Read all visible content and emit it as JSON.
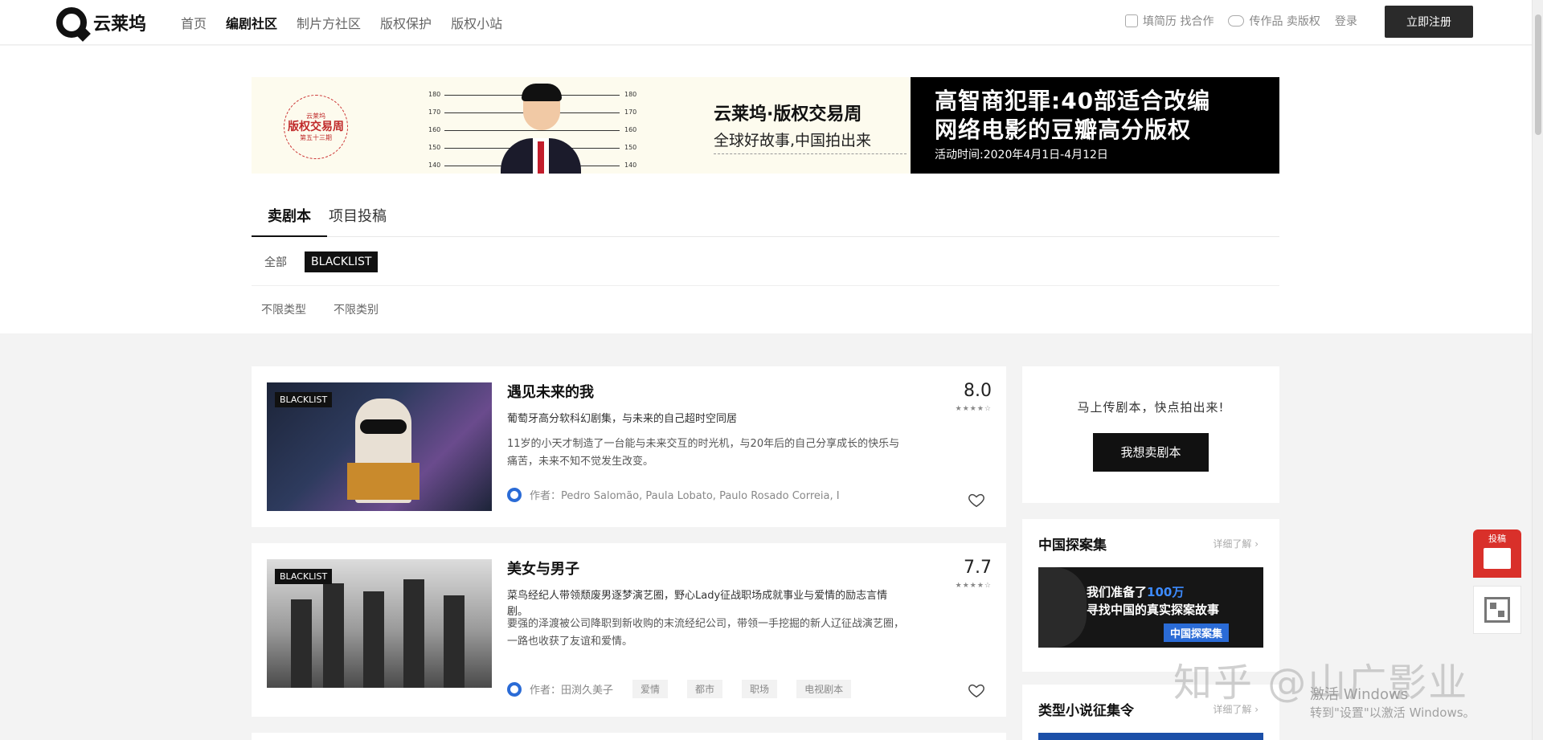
{
  "nav": {
    "logo_text": "云莱坞",
    "links": [
      "首页",
      "编剧社区",
      "制片方社区",
      "版权保护",
      "版权小站"
    ],
    "resume_label": "填简历 找合作",
    "upload_label": "传作品 卖版权",
    "login_label": "登录",
    "register_label": "立即注册"
  },
  "banner": {
    "stamp_top": "云莱坞",
    "stamp_main": "版权交易周",
    "stamp_bottom": "第五十三期",
    "height_marks": [
      "180",
      "170",
      "160",
      "150",
      "140"
    ],
    "mid_title": "云莱坞·版权交易周",
    "mid_sub": "全球好故事,中国拍出来",
    "right_line1": "高智商犯罪:40部适合改编",
    "right_line2": "网络电影的豆瓣高分版权",
    "right_time": "活动时间:2020年4月1日-4月12日"
  },
  "tabs": [
    "卖剧本",
    "项目投稿"
  ],
  "filters": {
    "row1": [
      "全部",
      "BLACKLIST"
    ],
    "selected": "BLACKLIST",
    "row2": [
      "不限类型",
      "不限类别"
    ]
  },
  "cards": [
    {
      "tag": "BLACKLIST",
      "title": "遇见未来的我",
      "subtitle": "葡萄牙高分软科幻剧集，与未来的自己超时空同居",
      "desc": "11岁的小天才制造了一台能与未来交互的时光机，与20年后的自己分享成长的快乐与痛苦，未来不知不觉发生改变。",
      "author": "作者：Pedro Salomão, Paula Lobato, Paulo Rosado Correia, I",
      "score": "8.0",
      "stars": 4,
      "genres": []
    },
    {
      "tag": "BLACKLIST",
      "title": "美女与男子",
      "subtitle": "菜鸟经纪人带领颓废男逐梦演艺圈，野心Lady征战职场成就事业与爱情的励志言情剧。",
      "desc": "要强的泽渡被公司降职到新收购的末流经纪公司，带领一手挖掘的新人辽征战演艺圈，一路也收获了友谊和爱情。",
      "author": "作者：田渕久美子",
      "score": "7.7",
      "stars": 4,
      "genres": [
        "爱情",
        "都市",
        "职场",
        "电视剧本"
      ]
    }
  ],
  "sidebar": {
    "tip": "马上传剧本，快点拍出来!",
    "sell_button": "我想卖剧本",
    "box2_title": "中国探案集",
    "box2_more": "详细了解 ›",
    "box2_line1_a": "我们准备了",
    "box2_line1_b": "100万",
    "box2_line2": "寻找中国的真实探案故事",
    "box2_btn": "中国探案集",
    "box3_title": "类型小说征集令",
    "box3_more": "详细了解 ›"
  },
  "float": {
    "submit_label": "投稿"
  },
  "watermark": {
    "zhihu": "知乎 @山广影业",
    "win1": "激活 Windows",
    "win2": "转到\"设置\"以激活 Windows。"
  }
}
